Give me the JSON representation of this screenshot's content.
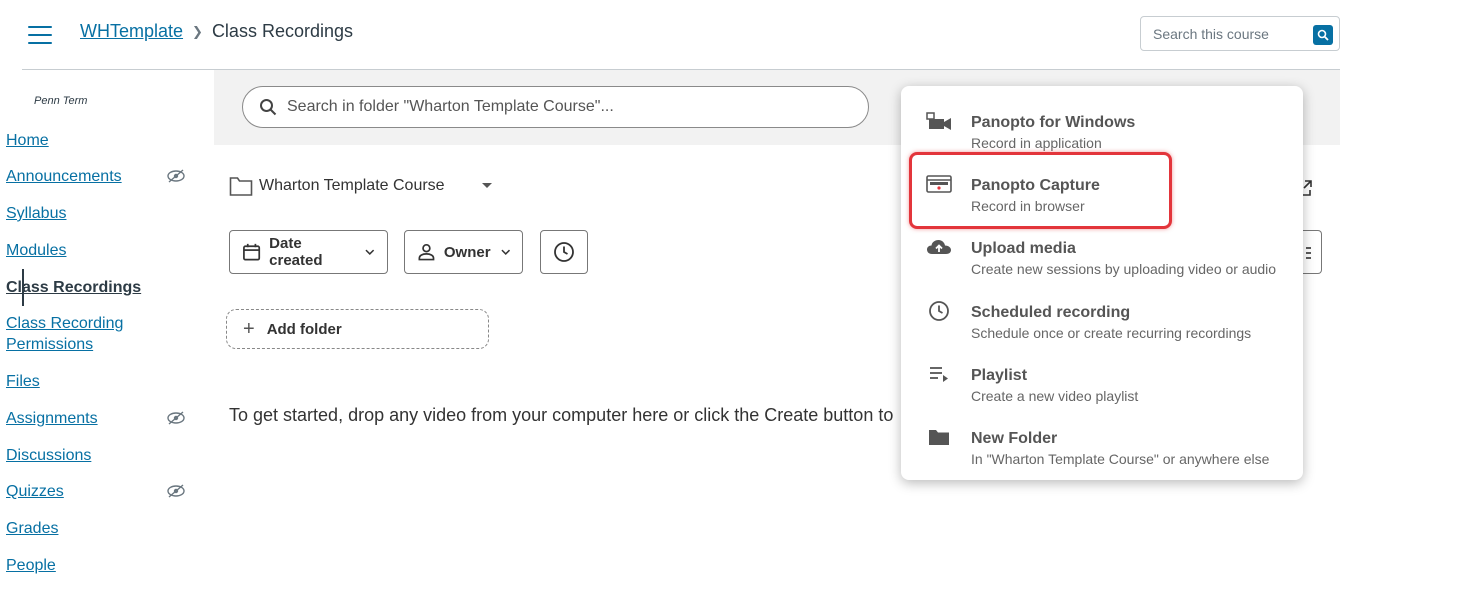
{
  "header": {
    "breadcrumb_course": "WHTemplate",
    "breadcrumb_page": "Class Recordings",
    "search_placeholder": "Search this course"
  },
  "sidebar": {
    "term": "Penn Term",
    "items": [
      {
        "label": "Home",
        "hidden": false
      },
      {
        "label": "Announcements",
        "hidden": true
      },
      {
        "label": "Syllabus",
        "hidden": false
      },
      {
        "label": "Modules",
        "hidden": false
      },
      {
        "label": "Class Recordings",
        "hidden": false,
        "active": true
      },
      {
        "label": "Class Recording Permissions",
        "hidden": false
      },
      {
        "label": "Files",
        "hidden": false
      },
      {
        "label": "Assignments",
        "hidden": true
      },
      {
        "label": "Discussions",
        "hidden": false
      },
      {
        "label": "Quizzes",
        "hidden": true
      },
      {
        "label": "Grades",
        "hidden": false
      },
      {
        "label": "People",
        "hidden": false
      }
    ]
  },
  "panopto": {
    "folder_search_placeholder": "Search in folder \"Wharton Template Course\"...",
    "folder_name": "Wharton Template Course",
    "filters": {
      "date_label": "Date created",
      "owner_label": "Owner"
    },
    "add_folder_label": "Add folder",
    "empty_message": "To get started, drop any video from your computer here or click the Create button to"
  },
  "create_menu": {
    "items": [
      {
        "title": "Panopto for Windows",
        "subtitle": "Record in application",
        "icon": "video-camera-icon"
      },
      {
        "title": "Panopto Capture",
        "subtitle": "Record in browser",
        "icon": "browser-capture-icon",
        "highlighted": true
      },
      {
        "title": "Upload media",
        "subtitle": "Create new sessions by uploading video or audio",
        "icon": "cloud-upload-icon"
      },
      {
        "title": "Scheduled recording",
        "subtitle": "Schedule once or create recurring recordings",
        "icon": "clock-icon"
      },
      {
        "title": "Playlist",
        "subtitle": "Create a new video playlist",
        "icon": "playlist-icon"
      },
      {
        "title": "New Folder",
        "subtitle": "In \"Wharton Template Course\" or anywhere else",
        "icon": "folder-icon"
      }
    ]
  },
  "colors": {
    "link": "#0770a3",
    "highlight": "#e3353b",
    "toolbar_bg": "#f2f2f2"
  }
}
